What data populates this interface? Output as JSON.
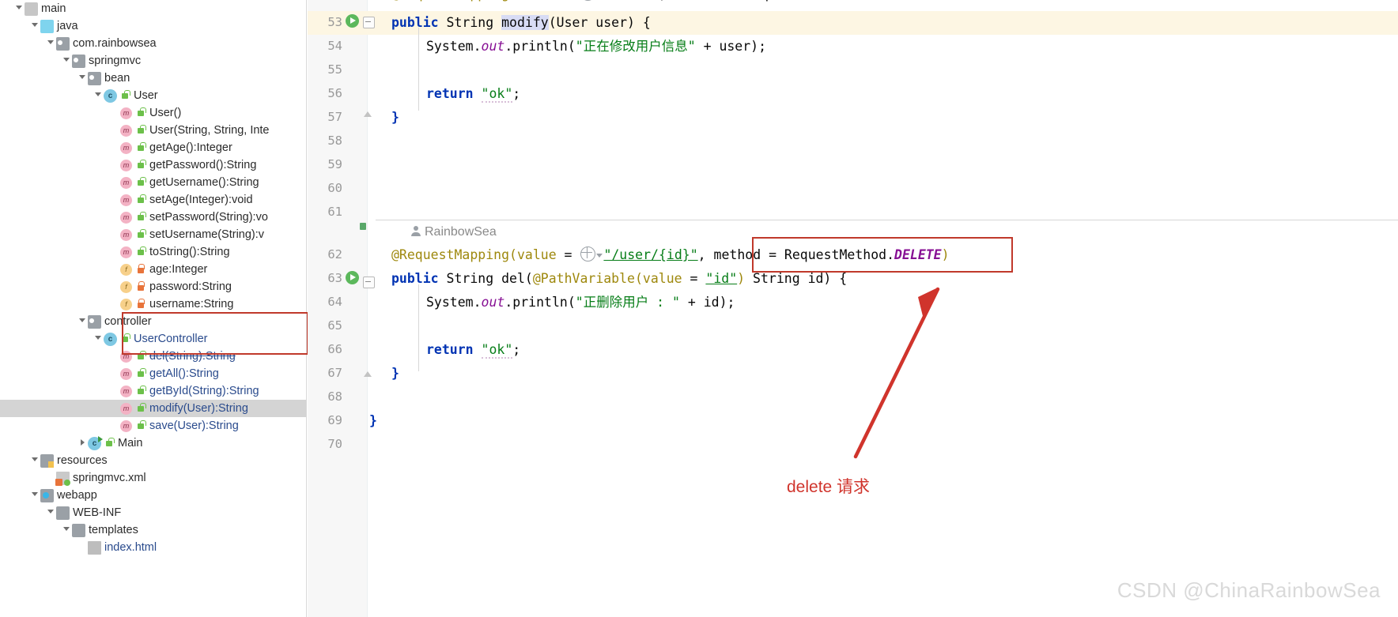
{
  "project_tree": {
    "scrollbar": "vertical-scrollbar",
    "items": [
      {
        "indent": 2,
        "arrow": "open",
        "icon": "folder-mod",
        "badge": "",
        "label": "main",
        "style": "plain"
      },
      {
        "indent": 3,
        "arrow": "open",
        "icon": "folder-blue",
        "badge": "",
        "label": "java",
        "style": "plain"
      },
      {
        "indent": 4,
        "arrow": "open",
        "icon": "folder-grey",
        "badge": "",
        "label": "com.rainbowsea",
        "style": "plain"
      },
      {
        "indent": 5,
        "arrow": "open",
        "icon": "folder-grey",
        "badge": "",
        "label": "springmvc",
        "style": "plain"
      },
      {
        "indent": 6,
        "arrow": "open",
        "icon": "folder-grey",
        "badge": "",
        "label": "bean",
        "style": "plain"
      },
      {
        "indent": 7,
        "arrow": "open",
        "icon": "cls",
        "badge": "pub",
        "label": "User",
        "style": "plain"
      },
      {
        "indent": 8,
        "arrow": "none",
        "icon": "meth",
        "badge": "pub",
        "label": "User()",
        "style": "plain"
      },
      {
        "indent": 8,
        "arrow": "none",
        "icon": "meth",
        "badge": "pub",
        "label": "User(String, String, Inte",
        "style": "plain"
      },
      {
        "indent": 8,
        "arrow": "none",
        "icon": "meth",
        "badge": "pub",
        "label": "getAge():Integer",
        "style": "plain"
      },
      {
        "indent": 8,
        "arrow": "none",
        "icon": "meth",
        "badge": "pub",
        "label": "getPassword():String",
        "style": "plain"
      },
      {
        "indent": 8,
        "arrow": "none",
        "icon": "meth",
        "badge": "pub",
        "label": "getUsername():String",
        "style": "plain"
      },
      {
        "indent": 8,
        "arrow": "none",
        "icon": "meth",
        "badge": "pub",
        "label": "setAge(Integer):void",
        "style": "plain"
      },
      {
        "indent": 8,
        "arrow": "none",
        "icon": "meth",
        "badge": "pub",
        "label": "setPassword(String):vo",
        "style": "plain"
      },
      {
        "indent": 8,
        "arrow": "none",
        "icon": "meth",
        "badge": "pub",
        "label": "setUsername(String):v",
        "style": "plain"
      },
      {
        "indent": 8,
        "arrow": "none",
        "icon": "meth",
        "badge": "pub",
        "label": "toString():String",
        "style": "plain"
      },
      {
        "indent": 8,
        "arrow": "none",
        "icon": "field",
        "badge": "priv",
        "label": "age:Integer",
        "style": "plain"
      },
      {
        "indent": 8,
        "arrow": "none",
        "icon": "field",
        "badge": "priv",
        "label": "password:String",
        "style": "plain"
      },
      {
        "indent": 8,
        "arrow": "none",
        "icon": "field",
        "badge": "priv",
        "label": "username:String",
        "style": "plain"
      },
      {
        "indent": 6,
        "arrow": "open",
        "icon": "folder-grey",
        "badge": "",
        "label": "controller",
        "style": "plain"
      },
      {
        "indent": 7,
        "arrow": "open",
        "icon": "cls",
        "badge": "pub",
        "label": "UserController",
        "style": "blue"
      },
      {
        "indent": 8,
        "arrow": "none",
        "icon": "meth",
        "badge": "pub",
        "label": "del(String):String",
        "style": "strike"
      },
      {
        "indent": 8,
        "arrow": "none",
        "icon": "meth",
        "badge": "pub",
        "label": "getAll():String",
        "style": "blue"
      },
      {
        "indent": 8,
        "arrow": "none",
        "icon": "meth",
        "badge": "pub",
        "label": "getById(String):String",
        "style": "blue"
      },
      {
        "indent": 8,
        "arrow": "none",
        "icon": "meth",
        "badge": "pub",
        "label": "modify(User):String",
        "style": "blue",
        "selected": true
      },
      {
        "indent": 8,
        "arrow": "none",
        "icon": "meth",
        "badge": "pub",
        "label": "save(User):String",
        "style": "blue"
      },
      {
        "indent": 6,
        "arrow": "closed",
        "icon": "cls-main",
        "badge": "pub",
        "label": "Main",
        "style": "plain"
      },
      {
        "indent": 3,
        "arrow": "open",
        "icon": "folder-src",
        "badge": "",
        "label": "resources",
        "style": "plain"
      },
      {
        "indent": 4,
        "arrow": "none",
        "icon": "xml",
        "badge": "",
        "label": "springmvc.xml",
        "style": "plain"
      },
      {
        "indent": 3,
        "arrow": "open",
        "icon": "folder-web",
        "badge": "",
        "label": "webapp",
        "style": "plain"
      },
      {
        "indent": 4,
        "arrow": "open",
        "icon": "folder-plain",
        "badge": "",
        "label": "WEB-INF",
        "style": "plain"
      },
      {
        "indent": 5,
        "arrow": "open",
        "icon": "folder-plain",
        "badge": "",
        "label": "templates",
        "style": "plain"
      },
      {
        "indent": 6,
        "arrow": "none",
        "icon": "html",
        "badge": "",
        "label": "index.html",
        "style": "blue"
      }
    ]
  },
  "editor": {
    "line_numbers": [
      "53",
      "54",
      "55",
      "56",
      "57",
      "58",
      "59",
      "60",
      "61",
      "62",
      "63",
      "64",
      "65",
      "66",
      "67",
      "68",
      "69",
      "70"
    ],
    "partial_top_line": "@RequestMapping(value =  ∨\"/user\", method = RequestMethod.PUT)",
    "author_hint": "RainbowSea",
    "code_lines": {
      "l53": "public String modify(User user) {",
      "l54": "System.out.println(\"正在修改用户信息\" + user);",
      "l56": "return \"ok\";",
      "l57": "}",
      "l62_a": "@RequestMapping(value = ",
      "l62_url": "\"/user/{id}\"",
      "l62_b": ", method = RequestMethod.DELETE)",
      "l63": "public String del(@PathVariable(value = \"id\") String id) {",
      "l64": "System.out.println(\"正删除用户 : \" + id);",
      "l66": "return \"ok\";",
      "l67": "}",
      "l69": "}"
    },
    "tokens": {
      "kw_public": "public",
      "type_String": "String",
      "method_modify": "modify",
      "param_User_user": "(User user) {",
      "sys_out_println_1_pre": "System.",
      "sys_out": "out",
      "println": ".println(",
      "str_modify_msg": "\"正在修改用户信息\"",
      "plus_user": " + user);",
      "kw_return": "return",
      "str_ok": "\"ok\"",
      "semi": ";",
      "brace_close": "}",
      "anno_req_mapping": "@RequestMapping",
      "paren_open": "(",
      "value_eq": "value = ",
      "url_user_id": "\"/user/{id}\"",
      "comma": ", ",
      "method_eq": "method = RequestMethod.",
      "enum_delete": "DELETE",
      "paren_close": ")",
      "method_del": "del",
      "anno_pathvariable": "@PathVariable",
      "pv_value_eq": "value = ",
      "pv_id": "\"id\"",
      "pv_tail": ") String id) {",
      "str_del_msg": "\"正删除用户 : \"",
      "plus_id": " + id);"
    }
  },
  "annotations": {
    "delete_note": "delete 请求",
    "red_box_tree": "red-highlight-controller",
    "red_box_delete": "red-highlight-delete-method",
    "arrow": "red-arrow-pointing-to-delete"
  },
  "watermark": {
    "text": "CSDN @ChinaRainbowSea"
  },
  "colors": {
    "annotation_red": "#c0392b",
    "note_red": "#d0342c",
    "keyword_blue": "#0033b3",
    "string_green": "#067d17",
    "annotation_yellow": "#9e880d",
    "field_purple": "#871094",
    "selected_row": "#d4d4d4",
    "current_line": "#fdf6e3",
    "watermark_grey": "#d9d9d9"
  }
}
